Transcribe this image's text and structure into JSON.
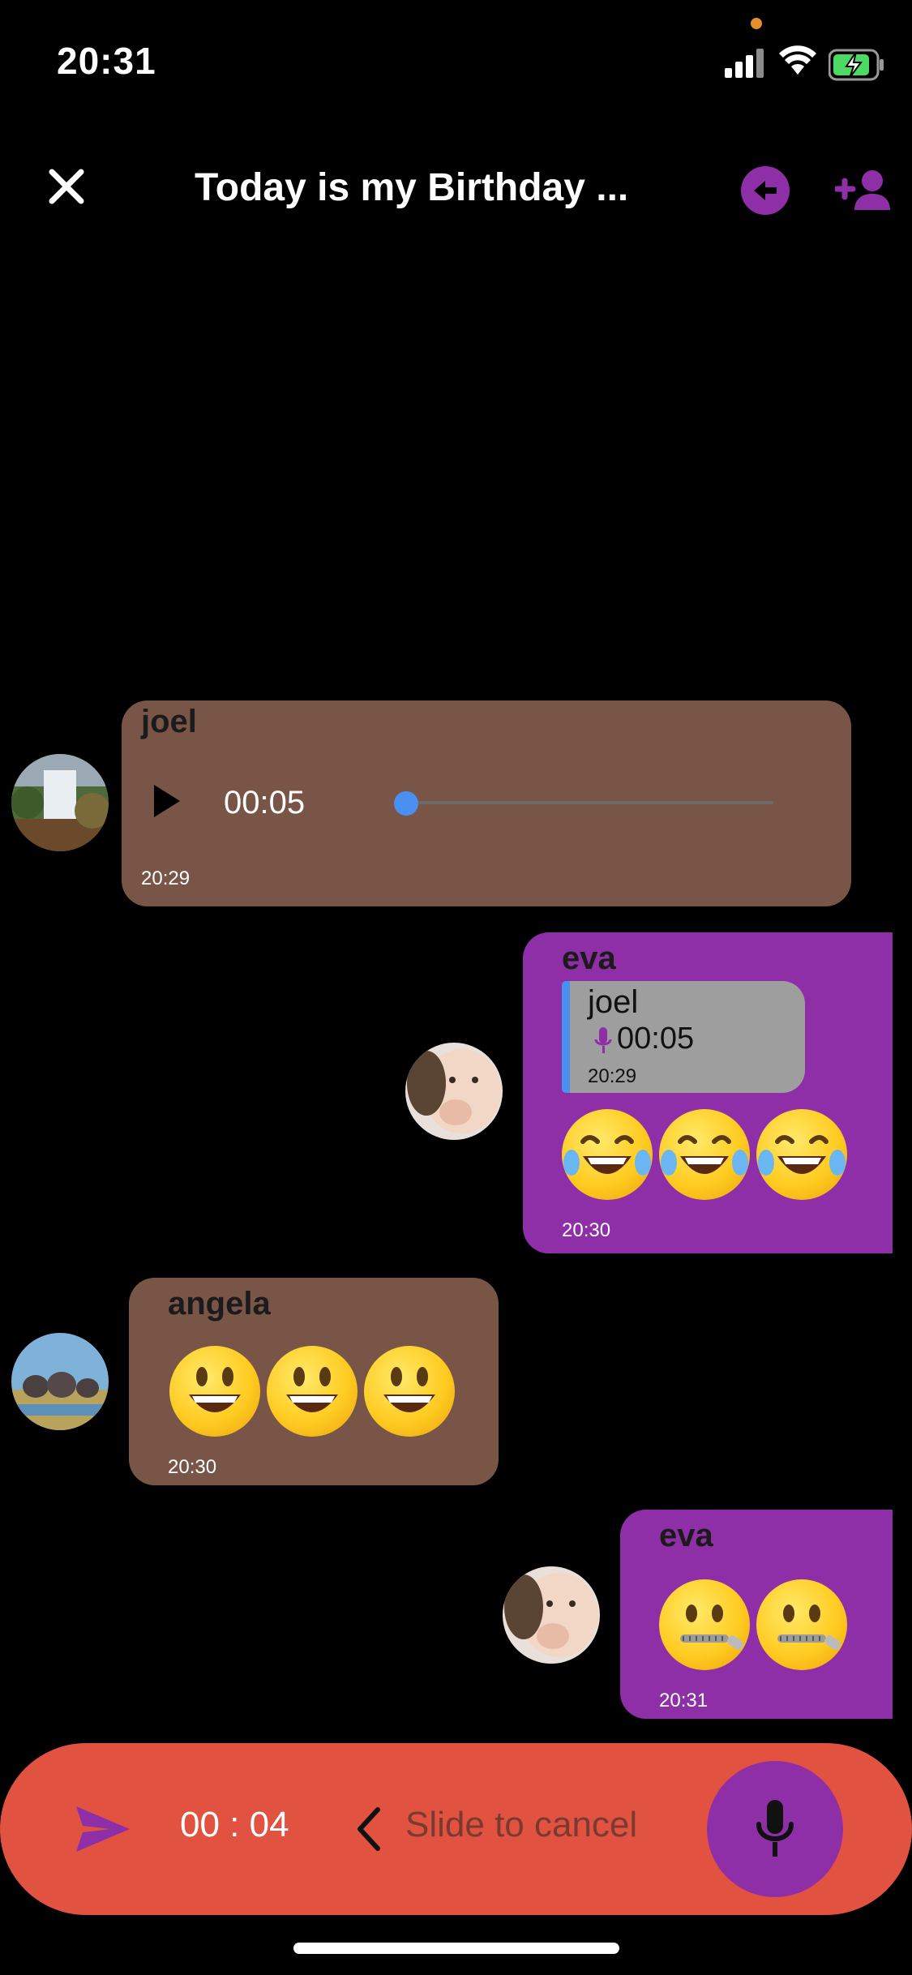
{
  "status": {
    "time": "20:31"
  },
  "header": {
    "title": "Today is my Birthday ..."
  },
  "messages": [
    {
      "sender": "joel",
      "type": "voice",
      "duration": "00:05",
      "time": "20:29",
      "progress": 0
    },
    {
      "sender": "eva",
      "reply": {
        "sender": "joel",
        "duration": "00:05",
        "time": "20:29"
      },
      "emoji": [
        "laughing-tears",
        "laughing-tears",
        "laughing-tears"
      ],
      "time": "20:30"
    },
    {
      "sender": "angela",
      "emoji": [
        "smiley",
        "smiley",
        "smiley"
      ],
      "time": "20:30"
    },
    {
      "sender": "eva",
      "emoji": [
        "zipper-mouth",
        "zipper-mouth"
      ],
      "time": "20:31"
    }
  ],
  "recorder": {
    "timer": "00 : 04",
    "slide_label": "Slide to cancel"
  },
  "colors": {
    "accent": "#8e2fa8",
    "bubble_other": "#795548",
    "recording_bar": "#e25240",
    "seek": "#4a90f0"
  },
  "icons": [
    "close-icon",
    "arrow-left-icon",
    "person-add-icon",
    "play-icon",
    "mic-icon",
    "send-icon",
    "chevron-left-icon"
  ]
}
